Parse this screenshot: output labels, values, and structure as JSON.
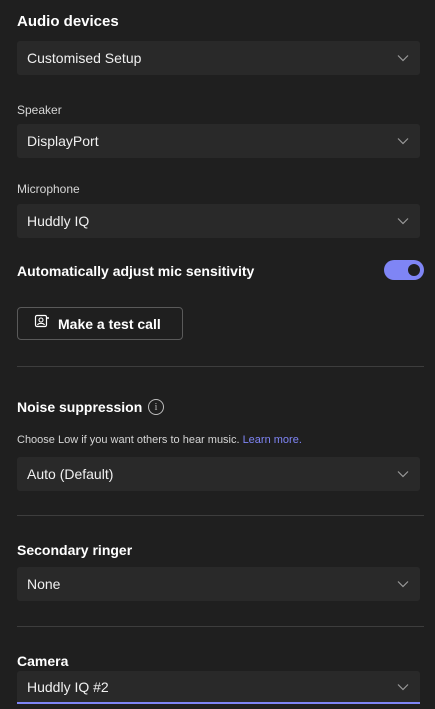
{
  "audio_devices": {
    "title": "Audio devices",
    "setup_value": "Customised Setup"
  },
  "speaker": {
    "label": "Speaker",
    "value": "DisplayPort"
  },
  "microphone": {
    "label": "Microphone",
    "value": "Huddly IQ"
  },
  "auto_adjust": {
    "label": "Automatically adjust mic sensitivity",
    "enabled": true
  },
  "test_call": {
    "label": "Make a test call"
  },
  "noise_suppression": {
    "title": "Noise suppression",
    "hint": "Choose Low if you want others to hear music.",
    "learn_more": "Learn more.",
    "value": "Auto (Default)"
  },
  "secondary_ringer": {
    "title": "Secondary ringer",
    "value": "None"
  },
  "camera": {
    "title": "Camera",
    "value": "Huddly IQ #2"
  },
  "colors": {
    "background": "#1f1f1f",
    "field": "#292929",
    "accent": "#7f85f5"
  }
}
